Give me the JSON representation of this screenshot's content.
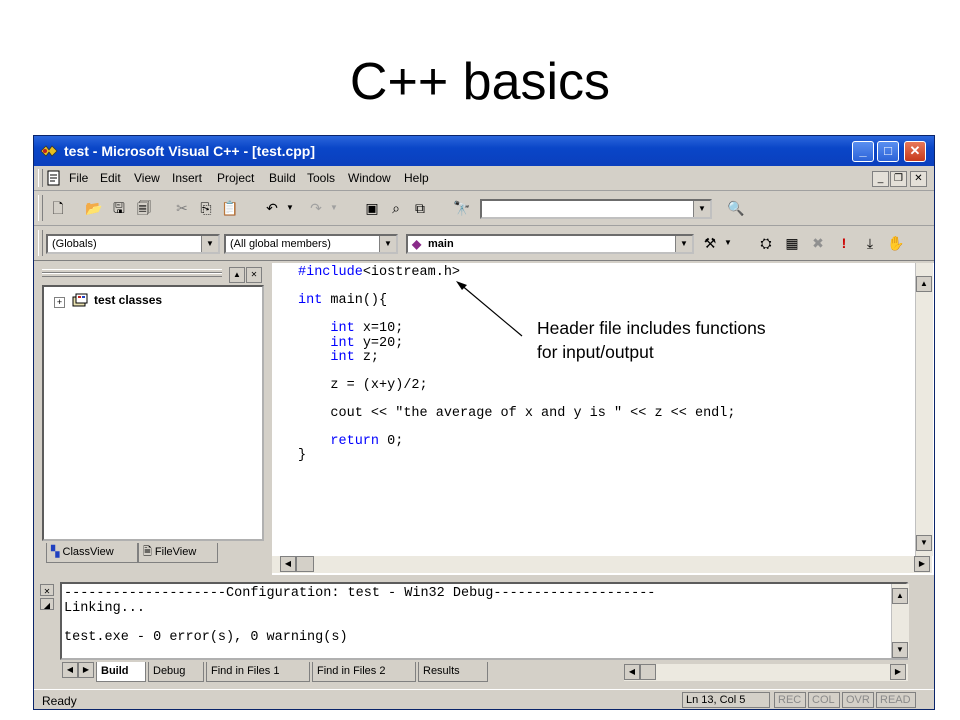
{
  "slide": {
    "title": "C++ basics"
  },
  "window": {
    "title": "test - Microsoft Visual C++ - [test.cpp]"
  },
  "menu": [
    "File",
    "Edit",
    "View",
    "Insert",
    "Project",
    "Build",
    "Tools",
    "Window",
    "Help"
  ],
  "toolbar": {
    "find_combo": "",
    "globals_combo": "(Globals)",
    "members_combo": "(All global members)",
    "function_combo": "main"
  },
  "workspace": {
    "tree_root": "test classes",
    "tabs": [
      "ClassView",
      "FileView"
    ]
  },
  "code": [
    "#include<iostream.h>",
    "",
    "int main(){",
    "",
    "    int x=10;",
    "    int y=20;",
    "    int z;",
    "",
    "    z = (x+y)/2;",
    "",
    "    cout << \"the average of x and y is \" << z << endl;",
    "",
    "    return 0;",
    "}"
  ],
  "output": {
    "lines": [
      "--------------------Configuration: test - Win32 Debug--------------------",
      "Linking...",
      "",
      "test.exe - 0 error(s), 0 warning(s)"
    ],
    "tabs": [
      "Build",
      "Debug",
      "Find in Files 1",
      "Find in Files 2",
      "Results"
    ]
  },
  "status": {
    "text": "Ready",
    "position": "Ln 13, Col 5",
    "indicators": [
      "REC",
      "COL",
      "OVR",
      "READ"
    ]
  },
  "annotation": {
    "line1": "Header file includes functions",
    "line2": "for input/output"
  }
}
